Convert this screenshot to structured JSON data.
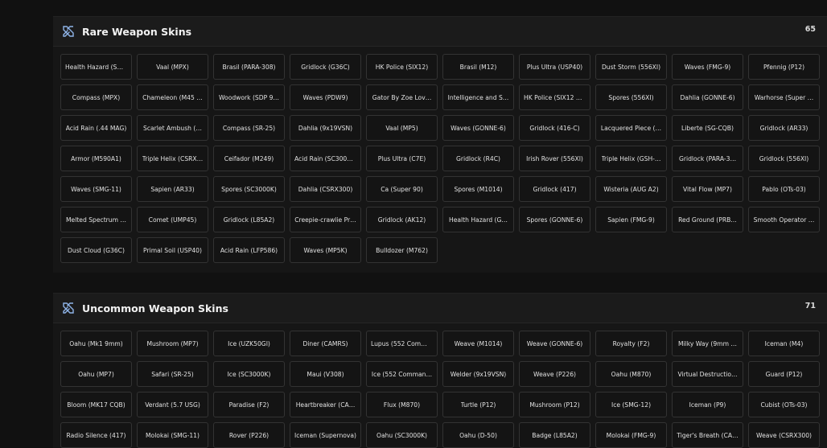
{
  "accent_color": "#8fb4e8",
  "sections": [
    {
      "icon": "crossed-swords-icon",
      "title": "Rare Weapon Skins",
      "count": "65",
      "items": [
        "Health Hazard (SA…",
        "Vaal (MPX)",
        "Brasil (PARA-308)",
        "Gridlock (G36C)",
        "HK Police (SIX12)",
        "Brasil (M12)",
        "Plus Ultra (USP40)",
        "Dust Storm (556XI)",
        "Waves (FMG-9)",
        "Pfennig (P12)",
        "Compass (MPX)",
        "Chameleon (M45 …",
        "Woodwork (SDP 9…",
        "Waves (PDW9)",
        "Gator By Zoe Lov…",
        "Intelligence and S…",
        "HK Police (SIX12 S…",
        "Spores (556XI)",
        "Dahlia (GONNE-6)",
        "Warhorse (Super …",
        "Acid Rain (.44 MAG)",
        "Scarlet Ambush (…",
        "Compass (SR-25)",
        "Dahlia (9x19VSN)",
        "Vaal (MP5)",
        "Waves (GONNE-6)",
        "Gridlock (416-C)",
        "Lacquered Piece (…",
        "Liberte (SG-CQB)",
        "Gridlock (AR33)",
        "Armor (M590A1)",
        "Triple Helix (CSRX…",
        "Ceifador (M249)",
        "Acid Rain (SC3000…",
        "Plus Ultra (C7E)",
        "Gridlock (R4C)",
        "Irish Rover (556XI)",
        "Triple Helix (GSH-…",
        "Gridlock (PARA-3…",
        "Gridlock (556XI)",
        "Waves (SMG-11)",
        "Sapien (AR33)",
        "Spores (SC3000K)",
        "Dahlia (CSRX300)",
        "Ca (Super 90)",
        "Spores (M1014)",
        "Gridlock (417)",
        "Wisteria (AUG A2)",
        "Vital Flow (MP7)",
        "Pablo (OTs-03)",
        "Melted Spectrum …",
        "Comet (UMP45)",
        "Gridlock (L85A2)",
        "Creepie-crawlie Pr…",
        "Gridlock (AK12)",
        "Health Hazard (G…",
        "Spores (GONNE-6)",
        "Sapien (FMG-9)",
        "Red Ground (PRB…",
        "Smooth Operator …",
        "Dust Cloud (G36C)",
        "Primal Soil (USP40)",
        "Acid Rain (LFP586)",
        "Waves (MP5K)",
        "Bulldozer (M762)"
      ]
    },
    {
      "icon": "crossed-swords-icon",
      "title": "Uncommon Weapon Skins",
      "count": "71",
      "items": [
        "Oahu (Mk1 9mm)",
        "Mushroom (MP7)",
        "Ice (UZK50GI)",
        "Diner (CAMRS)",
        "Lupus (552 Comm…",
        "Weave (M1014)",
        "Weave (GONNE-6)",
        "Royalty (F2)",
        "Milky Way (9mm …",
        "Iceman (M4)",
        "Oahu (MP7)",
        "Safari (SR-25)",
        "Ice (SC3000K)",
        "Maui (V308)",
        "Ice (552 Comman…",
        "Welder (9x19VSN)",
        "Weave (P226)",
        "Oahu (M870)",
        "Virtual Destructio…",
        "Guard (P12)",
        "Bloom (MK17 CQB)",
        "Verdant (5.7 USG)",
        "Paradise (F2)",
        "Heartbreaker (CA…",
        "Flux (M870)",
        "Turtle (P12)",
        "Mushroom (P12)",
        "Ice (SMG-12)",
        "Iceman (P9)",
        "Cubist (OTs-03)",
        "Radio Silence (417)",
        "Molokai (SMG-11)",
        "Rover (P226)",
        "Iceman (Supernova)",
        "Oahu (SC3000K)",
        "Oahu (D-50)",
        "Badge (L85A2)",
        "Molokai (FMG-9)",
        "Tiger's Breath (CA…",
        "Weave (CSRX300)"
      ]
    }
  ]
}
